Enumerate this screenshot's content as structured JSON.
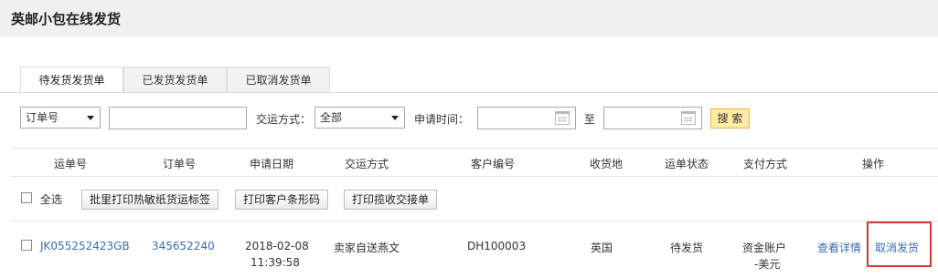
{
  "page": {
    "title": "英邮小包在线发货"
  },
  "tabs": [
    {
      "label": "待发货发货单",
      "active": true
    },
    {
      "label": "已发货发货单",
      "active": false
    },
    {
      "label": "已取消发货单",
      "active": false
    }
  ],
  "filters": {
    "field_select": "订单号",
    "keyword_value": "",
    "delivery_label": "交运方式：",
    "delivery_select": "全部",
    "apply_time_label": "申请时间：",
    "date_from": "",
    "to_label": "至",
    "date_to": "",
    "search_label": "搜 索"
  },
  "table": {
    "headers": [
      "运单号",
      "订单号",
      "申请日期",
      "交运方式",
      "客户编号",
      "收货地",
      "运单状态",
      "支付方式",
      "操作"
    ],
    "select_all_label": "全选",
    "bulk_actions": [
      "批里打印热敏纸货运标签",
      "打印客户条形码",
      "打印揽收交接单"
    ],
    "rows": [
      {
        "waybill_no": "JK055252423GB",
        "order_no": "345652240",
        "apply_date": "2018-02-08",
        "apply_time": "11:39:58",
        "delivery_method": "卖家自送燕文",
        "customer_no": "DH100003",
        "destination": "英国",
        "status": "待发货",
        "payment_line1": "资金账户",
        "payment_line2": "-美元",
        "action_view": "查看详情",
        "action_cancel": "取消发货"
      }
    ]
  },
  "colors": {
    "link": "#3a6db5",
    "highlight_border": "#d43a33",
    "search_button": "#ffeba3"
  }
}
